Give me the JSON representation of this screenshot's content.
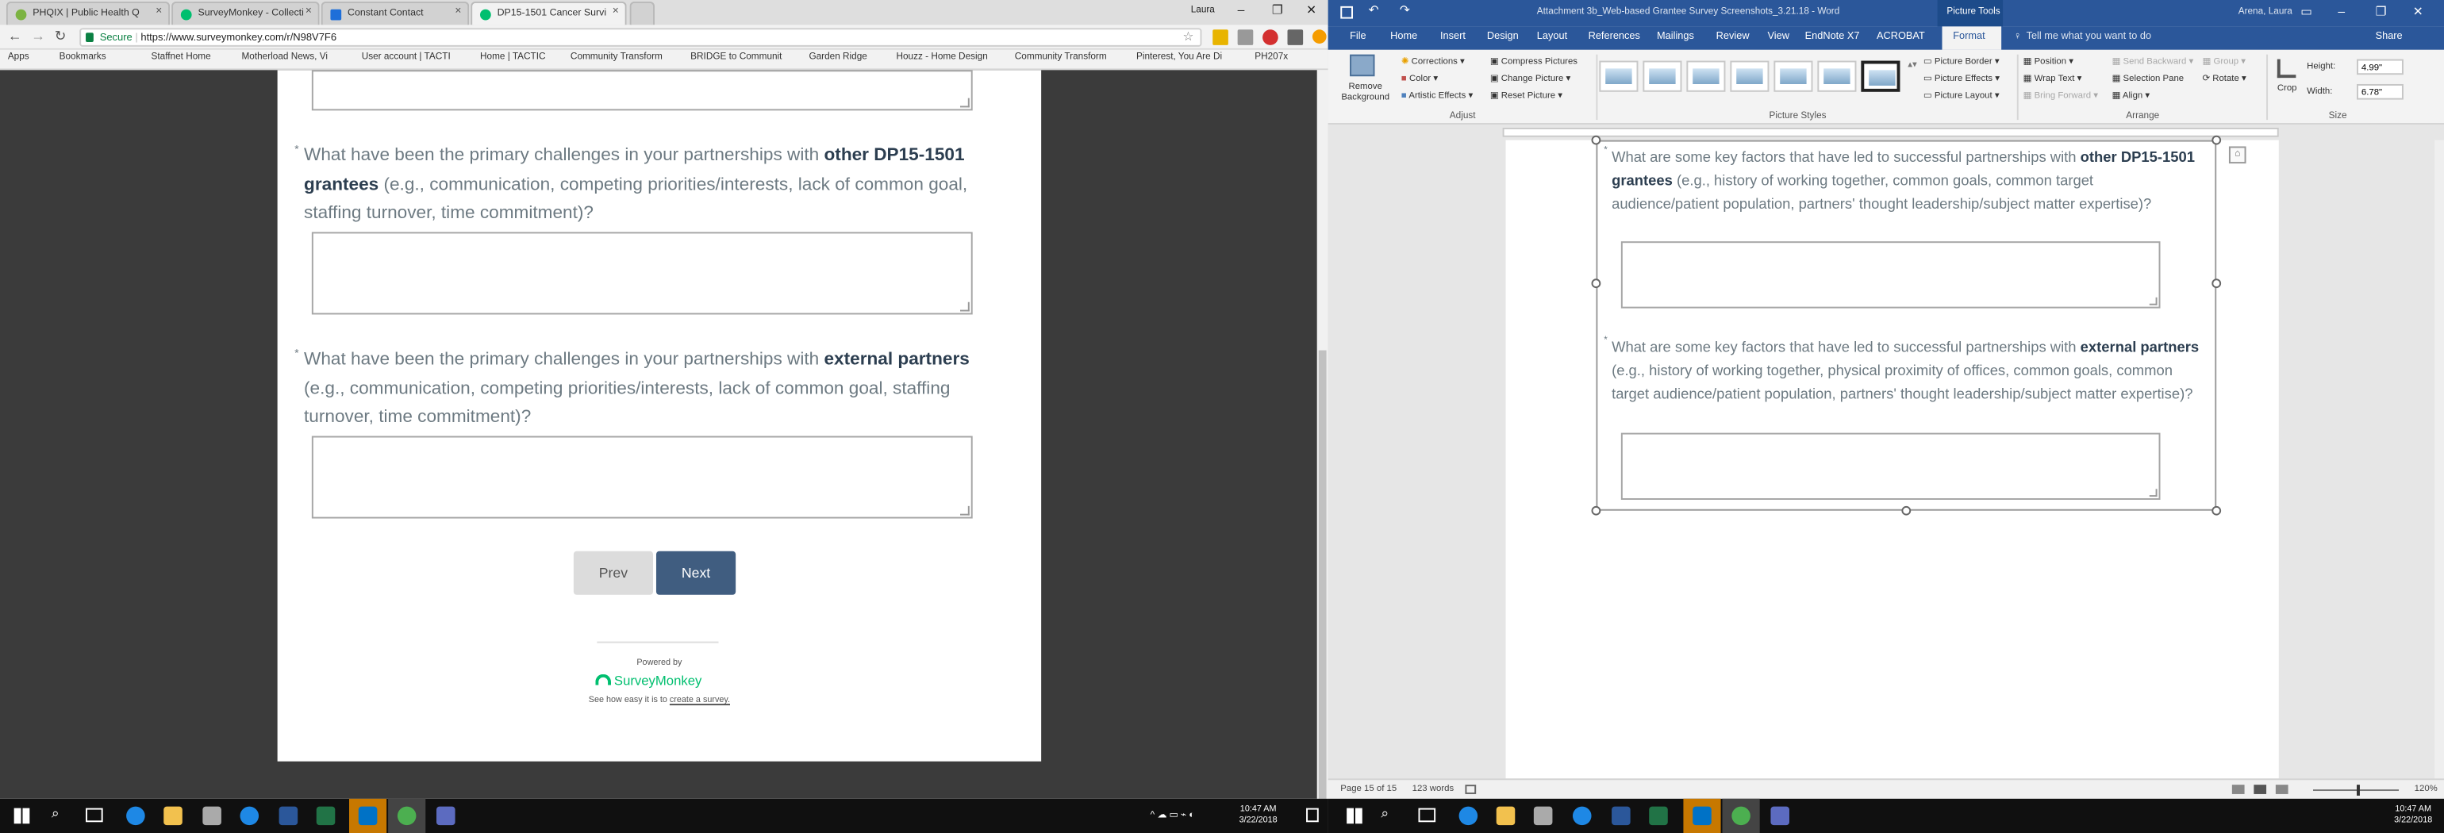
{
  "chrome": {
    "tabs": [
      {
        "label": "PHQIX | Public Health Q",
        "color": "#7cb342"
      },
      {
        "label": "SurveyMonkey - Collecti",
        "color": "#00bf6f"
      },
      {
        "label": "Constant Contact",
        "color": "#1e6fd9"
      },
      {
        "label": "DP15-1501 Cancer Survi",
        "color": "#00bf6f"
      }
    ],
    "user_label": "Laura",
    "secure_label": "Secure",
    "url": "https://www.surveymonkey.com/r/N98V7F6",
    "bookmarks": [
      "Apps",
      "Bookmarks",
      "Staffnet Home",
      "Motherload News, Vi",
      "User account | TACTI",
      "Home | TACTIC",
      "Community Transform",
      "BRIDGE to Communit",
      "Garden Ridge",
      "Houzz - Home Design",
      "Community Transform",
      "Pinterest, You Are Di",
      "PH207x"
    ]
  },
  "survey": {
    "q1": {
      "pre": "What have been the primary challenges in your partnerships with ",
      "bold": "other DP15-1501 grantees",
      "post": " (e.g., communication, competing priorities/interests, lack of common goal, staffing turnover, time commitment)?"
    },
    "q2": {
      "pre": "What have been the primary challenges in your partnerships with ",
      "bold": "external partners",
      "post": " (e.g., communication, competing priorities/interests, lack of common goal, staffing turnover, time commitment)?"
    },
    "prev_label": "Prev",
    "next_label": "Next",
    "powered_by": "Powered by",
    "brand": "SurveyMonkey",
    "footer_pre": "See how easy it is to ",
    "footer_link": "create a survey."
  },
  "word": {
    "title": "Attachment 3b_Web-based Grantee Survey Screenshots_3.21.18 - Word",
    "context_tab": "Picture Tools",
    "user": "Arena, Laura",
    "tabs": [
      "File",
      "Home",
      "Insert",
      "Design",
      "Layout",
      "References",
      "Mailings",
      "Review",
      "View",
      "EndNote X7",
      "ACROBAT",
      "Format"
    ],
    "tell_me": "Tell me what you want to do",
    "share": "Share",
    "ribbon": {
      "remove_bg": "Remove Background",
      "corrections": "Corrections",
      "color": "Color",
      "artistic": "Artistic Effects",
      "compress": "Compress Pictures",
      "change": "Change Picture",
      "reset": "Reset Picture",
      "adjust": "Adjust",
      "picture_styles": "Picture Styles",
      "border": "Picture Border",
      "effects": "Picture Effects",
      "layout": "Picture Layout",
      "position": "Position",
      "wrap": "Wrap Text",
      "bring_forward": "Bring Forward",
      "send_backward": "Send Backward",
      "selection_pane": "Selection Pane",
      "align": "Align",
      "group": "Group",
      "rotate": "Rotate",
      "arrange": "Arrange",
      "crop": "Crop",
      "height_label": "Height:",
      "height": "4.99\"",
      "width_label": "Width:",
      "width": "6.78\"",
      "size": "Size"
    },
    "q1": {
      "pre": "What are some key factors that have led to successful partnerships with ",
      "bold": "other DP15-1501 grantees",
      "post": " (e.g., history of working together, common goals, common target audience/patient population, partners' thought leadership/subject matter expertise)?"
    },
    "q2": {
      "pre": "What are some key factors that have led to successful partnerships with ",
      "bold": "external partners",
      "post": " (e.g., history of working together, physical proximity of offices, common goals, common target audience/patient population, partners' thought leadership/subject matter expertise)?"
    },
    "status_page": "Page 15 of 15",
    "status_words": "123 words",
    "zoom": "120%"
  },
  "taskbar": {
    "left_time": "10:47 AM",
    "left_date": "3/22/2018",
    "right_time": "10:47 AM",
    "right_date": "3/22/2018"
  }
}
